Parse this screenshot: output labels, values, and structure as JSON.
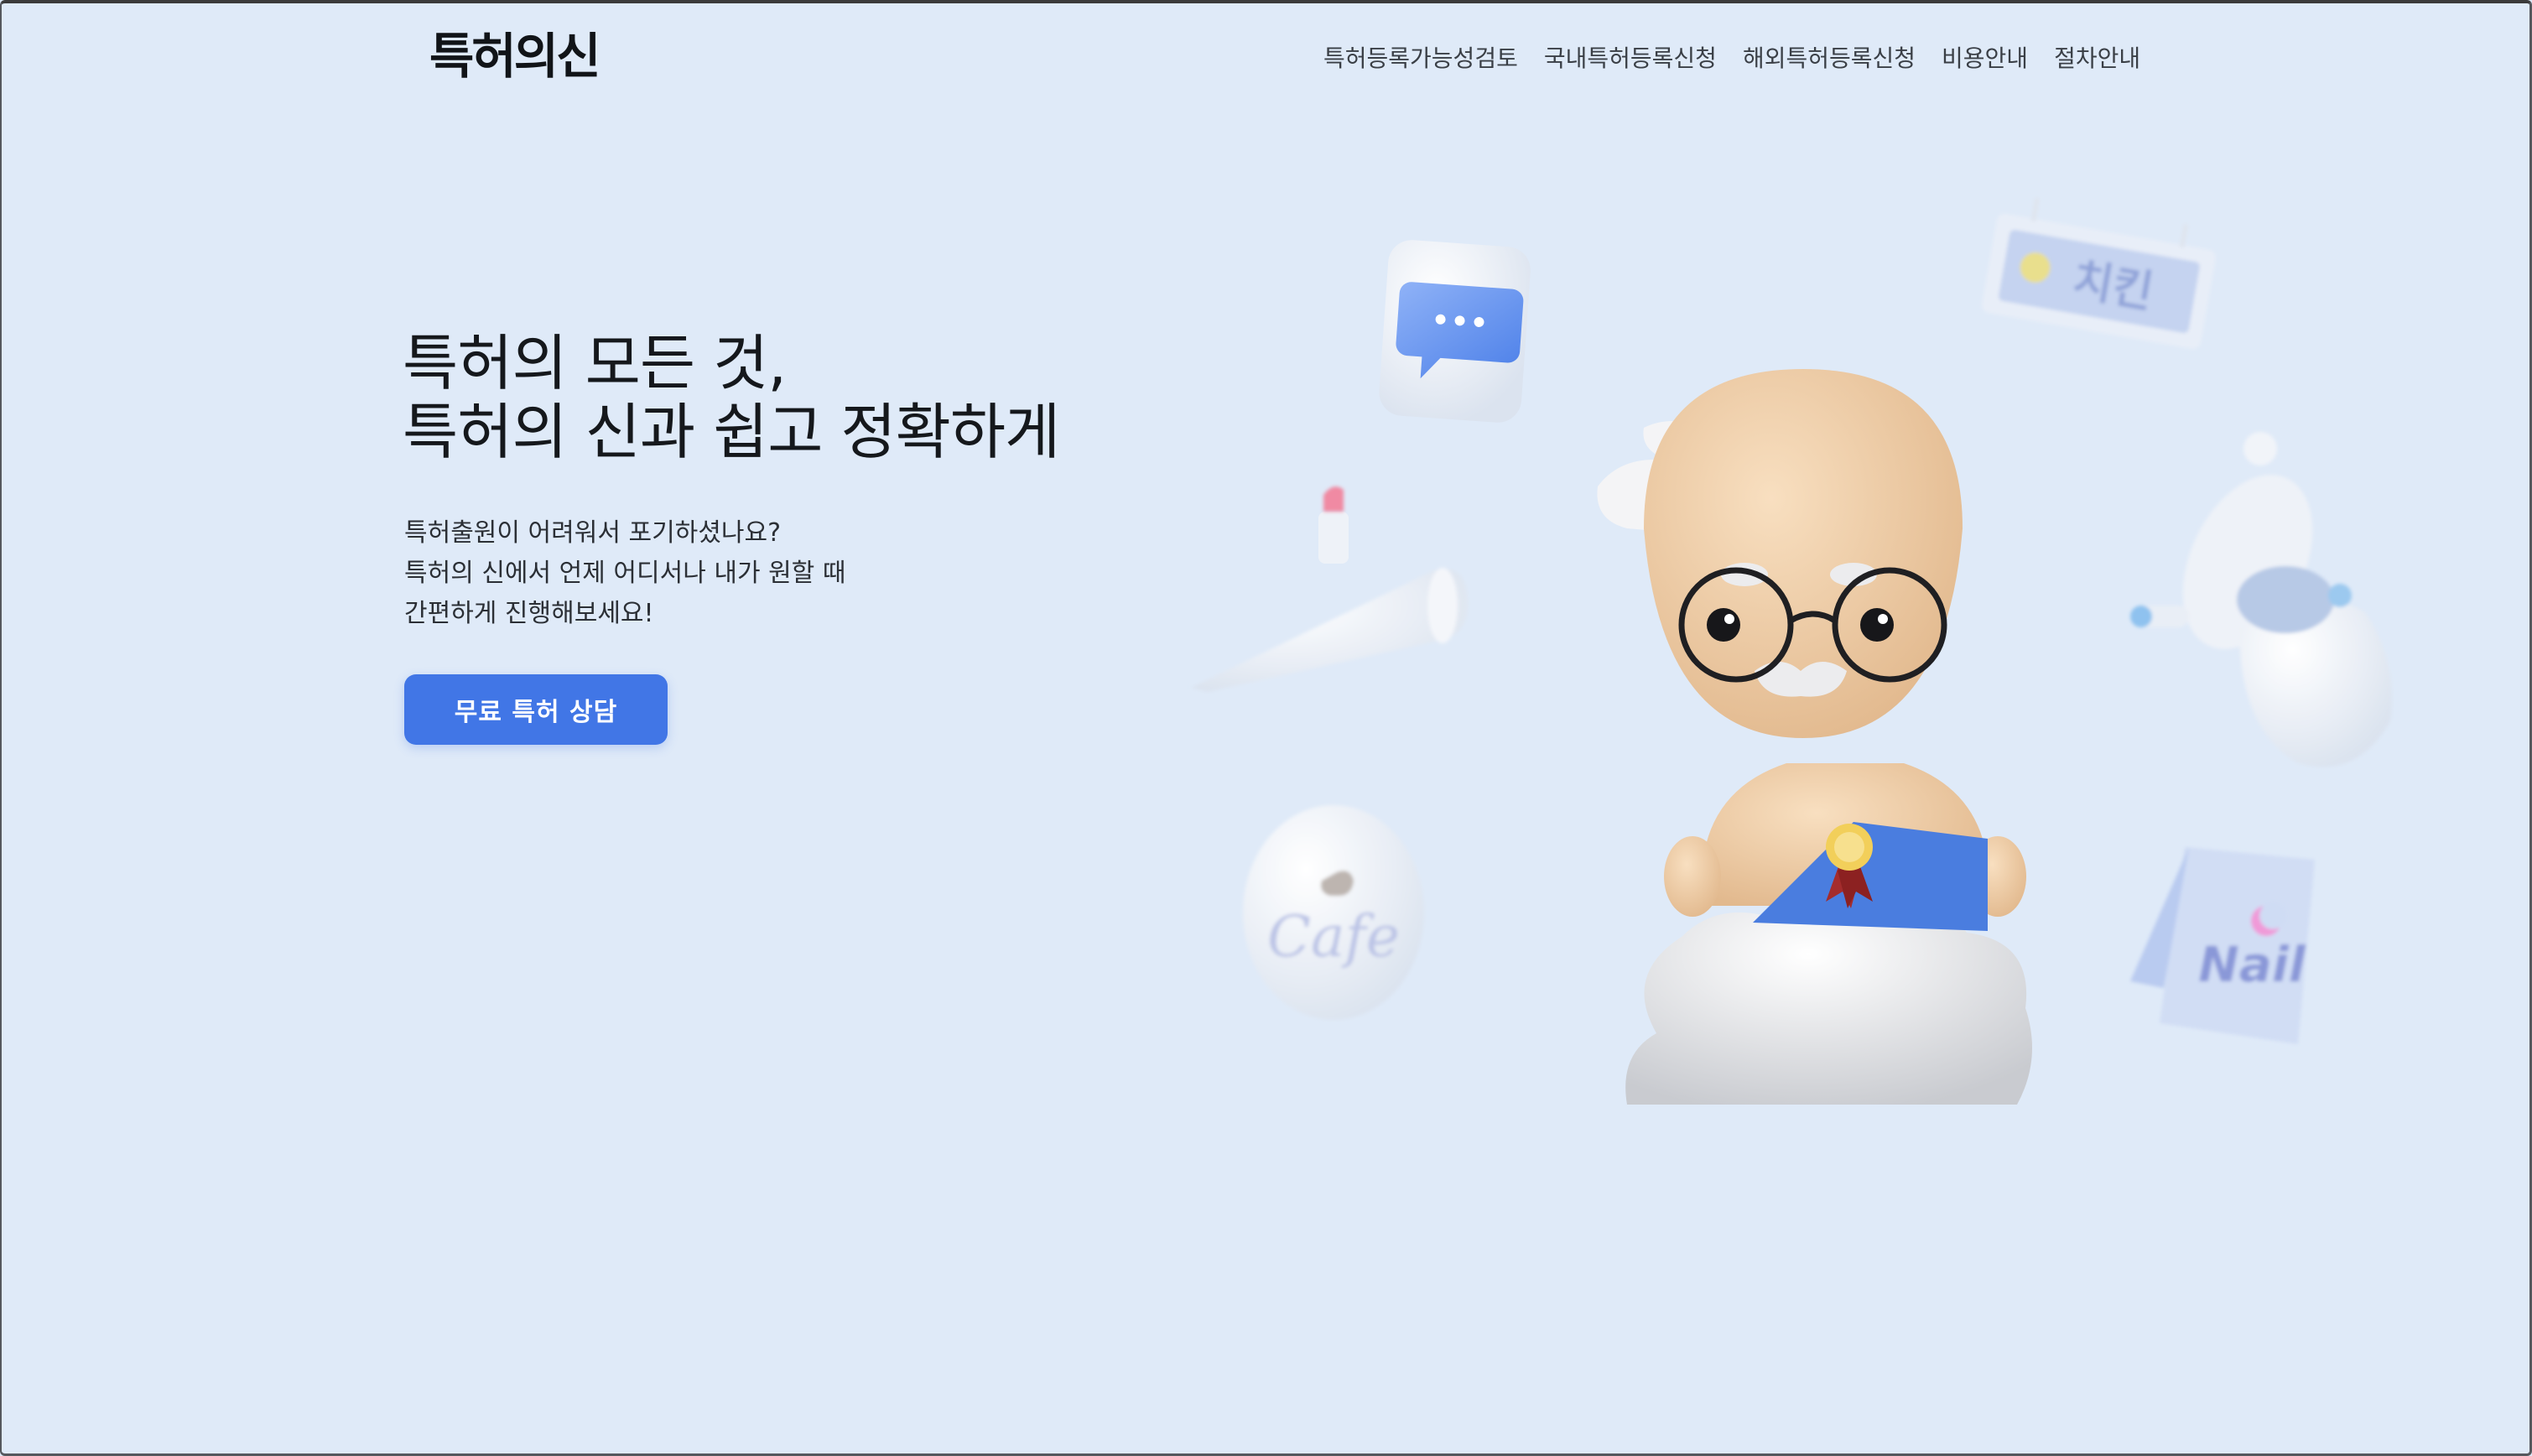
{
  "header": {
    "logo_text": "특허의신",
    "nav": [
      {
        "label": "특허등록가능성검토"
      },
      {
        "label": "국내특허등록신청"
      },
      {
        "label": "해외특허등록신청"
      },
      {
        "label": "비용안내"
      },
      {
        "label": "절차안내"
      }
    ]
  },
  "hero": {
    "title_lines": [
      "특허의 모든 것,",
      "특허의 신과 쉽고 정확하게"
    ],
    "description_lines": [
      "특허출원이 어려워서 포기하셨나요?",
      "특허의 신에서 언제 어디서나 내가 원할 때",
      "간편하게 진행해보세요!"
    ],
    "cta_label": "무료 특허 상담"
  },
  "illustration": {
    "cafe_label": "Cafe",
    "nail_label": "Nail",
    "sign_label": "치킨"
  },
  "colors": {
    "background": "#dfeaf8",
    "accent": "#4176e6"
  }
}
